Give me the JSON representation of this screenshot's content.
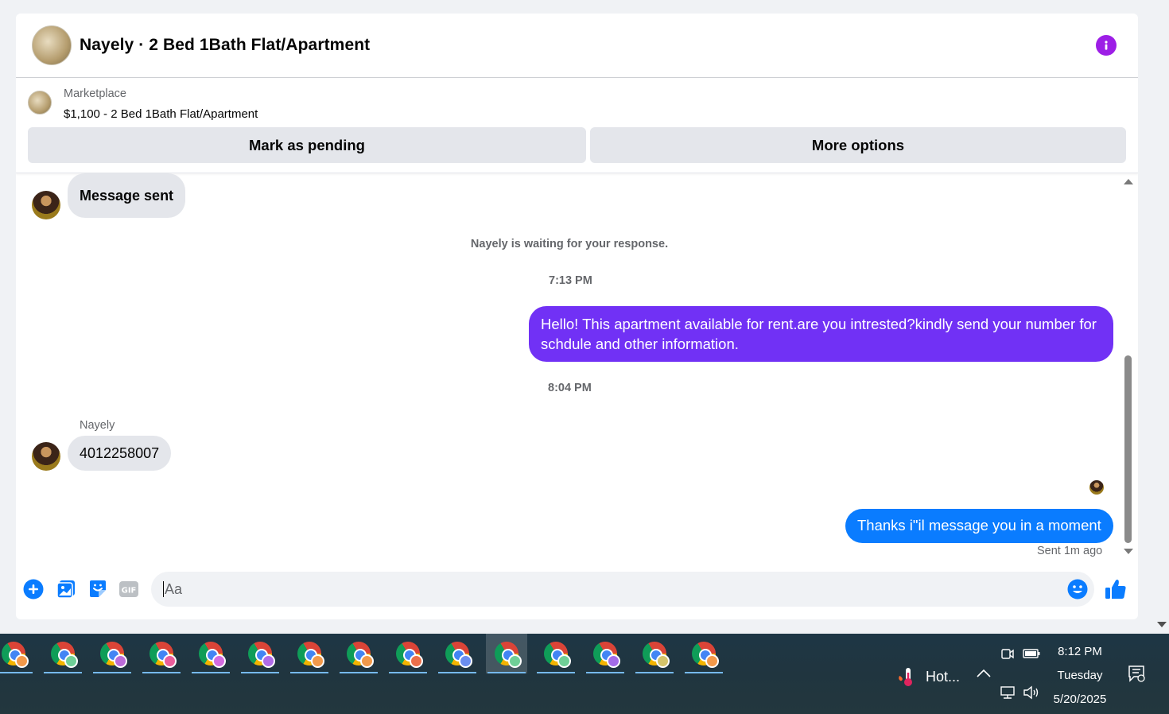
{
  "header": {
    "title": "Nayely · 2 Bed 1Bath Flat/Apartment"
  },
  "listing": {
    "category": "Marketplace",
    "title": "$1,100 - 2 Bed 1Bath Flat/Apartment",
    "pending_button": "Mark as pending",
    "more_button": "More options"
  },
  "thread": {
    "msg1": "Message sent",
    "waiting": "Nayely is waiting for your response.",
    "time1": "7:13 PM",
    "outgoing1": "Hello! This apartment available for rent.are you intrested?kindly send your number for schdule and other information.",
    "time2": "8:04 PM",
    "sender_name": "Nayely",
    "incoming2": "4012258007",
    "outgoing2": "Thanks i\"il message you in a moment",
    "sent_status": "Sent 1m ago"
  },
  "composer": {
    "placeholder": "Aa"
  },
  "colors": {
    "accent_purple": "#7131f5",
    "accent_blue": "#0a7cff",
    "info_icon": "#9d1ee6"
  },
  "taskbar": {
    "weather": "Hot...",
    "time": "8:12 PM",
    "day": "Tuesday",
    "date": "5/20/2025",
    "apps": [
      {
        "profile": "#f2994a"
      },
      {
        "profile": "#6fcf97"
      },
      {
        "profile": "#bb6bd9"
      },
      {
        "profile": "#eb5d9b"
      },
      {
        "profile": "#d46be0"
      },
      {
        "profile": "#b06be8"
      },
      {
        "profile": "#f2994a"
      },
      {
        "profile": "#f2994a"
      },
      {
        "profile": "#eb6f4a"
      },
      {
        "profile": "#6b8ef0"
      },
      {
        "profile": "#6fcf97"
      },
      {
        "profile": "#6fcf97"
      },
      {
        "profile": "#a36be8"
      },
      {
        "profile": "#d4c46b"
      },
      {
        "profile": "#f2994a"
      }
    ],
    "active_index": 10
  }
}
